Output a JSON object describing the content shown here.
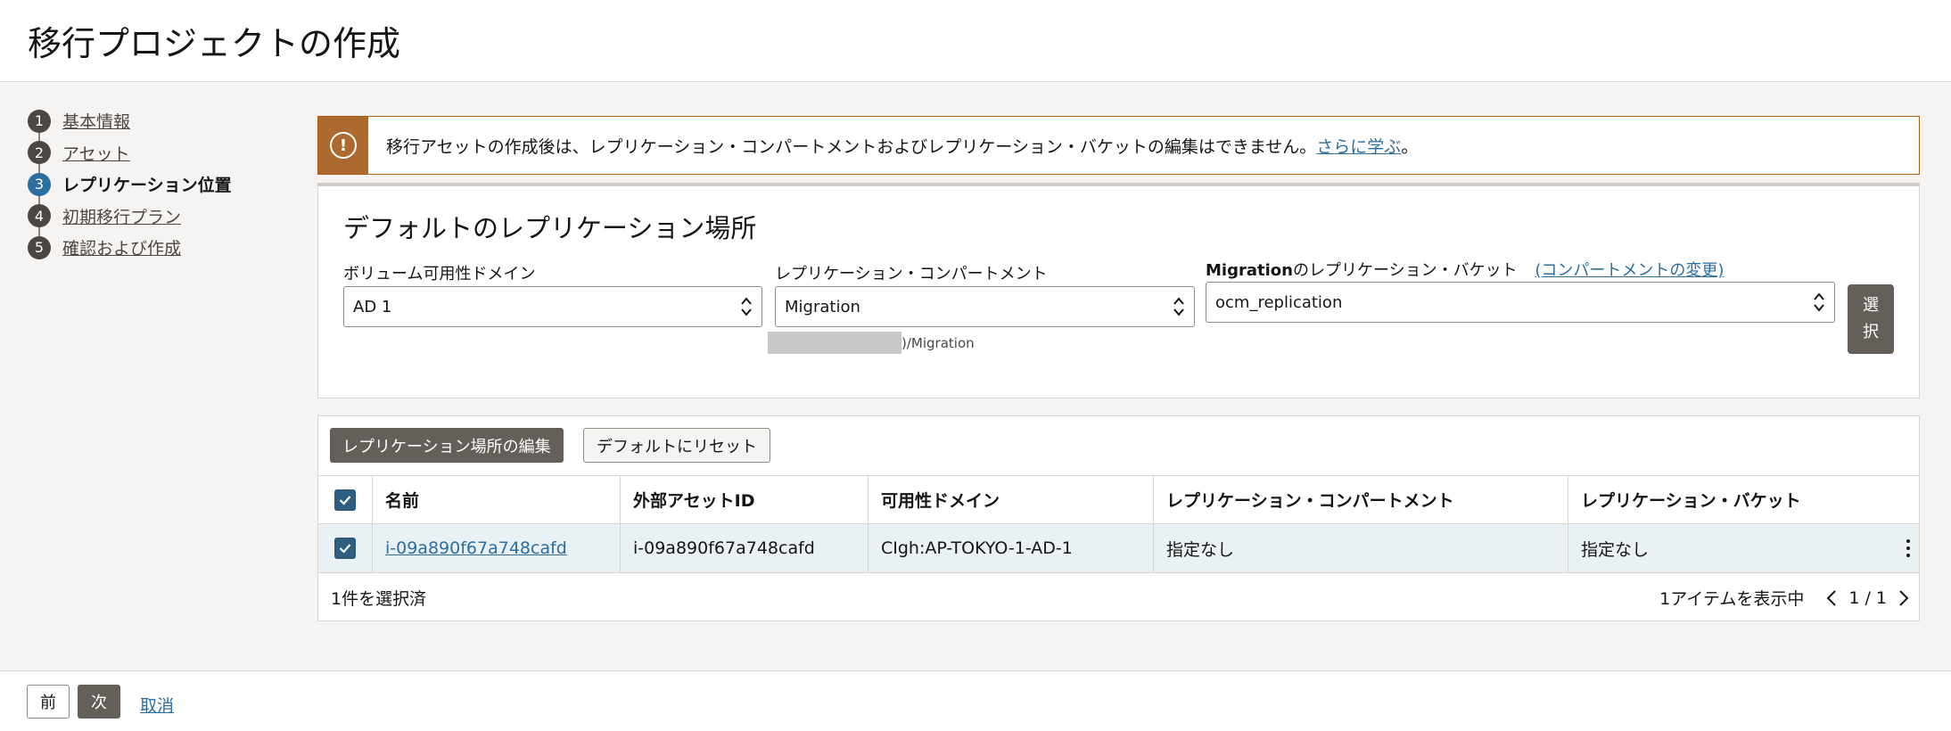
{
  "page": {
    "title": "移行プロジェクトの作成"
  },
  "steps": [
    {
      "num": "1",
      "label": "基本情報",
      "current": false
    },
    {
      "num": "2",
      "label": "アセット",
      "current": false
    },
    {
      "num": "3",
      "label": "レプリケーション位置",
      "current": true
    },
    {
      "num": "4",
      "label": "初期移行プラン",
      "current": false
    },
    {
      "num": "5",
      "label": "確認および作成",
      "current": false
    }
  ],
  "warning": {
    "text": "移行アセットの作成後は、レプリケーション・コンパートメントおよびレプリケーション・バケットの編集はできません。",
    "link": "さらに学ぶ",
    "suffix": "。"
  },
  "default_location": {
    "title": "デフォルトのレプリケーション場所",
    "ad_label": "ボリューム可用性ドメイン",
    "ad_value": "AD 1",
    "compartment_label": "レプリケーション・コンパートメント",
    "compartment_value": "Migration",
    "compartment_path": ")/Migration",
    "bucket_label_bold": "Migration",
    "bucket_label_rest": "のレプリケーション・バケット",
    "bucket_change_link": "(コンパートメントの変更)",
    "bucket_value": "ocm_replication",
    "select_button_line1": "選",
    "select_button_line2": "択"
  },
  "table": {
    "edit_button": "レプリケーション場所の編集",
    "reset_button": "デフォルトにリセット",
    "columns": [
      "名前",
      "外部アセットID",
      "可用性ドメイン",
      "レプリケーション・コンパートメント",
      "レプリケーション・バケット"
    ],
    "rows": [
      {
        "name": "i-09a890f67a748cafd",
        "external_id": "i-09a890f67a748cafd",
        "ad": "CIgh:AP-TOKYO-1-AD-1",
        "compartment": "指定なし",
        "bucket": "指定なし"
      }
    ],
    "selected_text": "1件を選択済",
    "showing_text": "1アイテムを表示中",
    "page_text": "1 / 1"
  },
  "footer": {
    "prev": "前",
    "next": "次",
    "cancel": "取消"
  }
}
